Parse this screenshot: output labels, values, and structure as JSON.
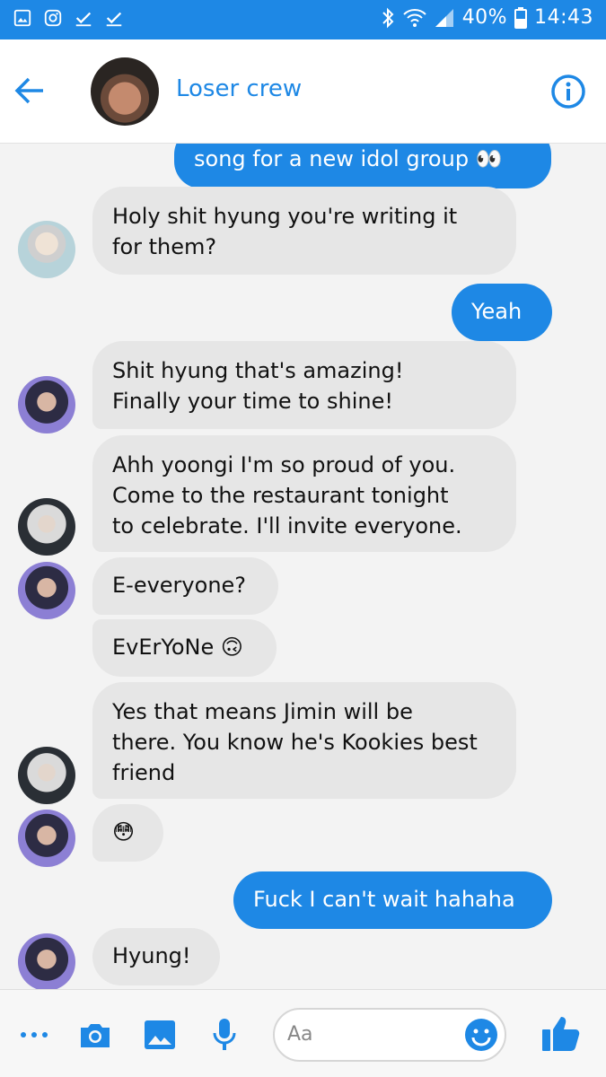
{
  "status_bar": {
    "battery": "40%",
    "time": "14:43"
  },
  "header": {
    "title": "Loser crew"
  },
  "messages": [
    {
      "text": "song for a new idol group 👀"
    },
    {
      "text": "Holy shit hyung you're writing it\nfor them?"
    },
    {
      "text": "Yeah"
    },
    {
      "text": "Shit hyung that's amazing!\nFinally your time to shine!"
    },
    {
      "text": "Ahh yoongi I'm so proud of you.\nCome to the restaurant tonight\nto celebrate. I'll invite everyone."
    },
    {
      "text": "E-everyone?"
    },
    {
      "text": "EvErYoNe 🙃"
    },
    {
      "text": "Yes that means Jimin will be\nthere. You know he's Kookies best\nfriend"
    },
    {
      "text": "😳"
    },
    {
      "text": "Fuck I can't wait hahaha"
    },
    {
      "text": "Hyung!"
    }
  ],
  "composer": {
    "placeholder": "Aa"
  },
  "colors": {
    "accent": "#1e88e5",
    "incoming_bubble": "#e6e6e6"
  }
}
